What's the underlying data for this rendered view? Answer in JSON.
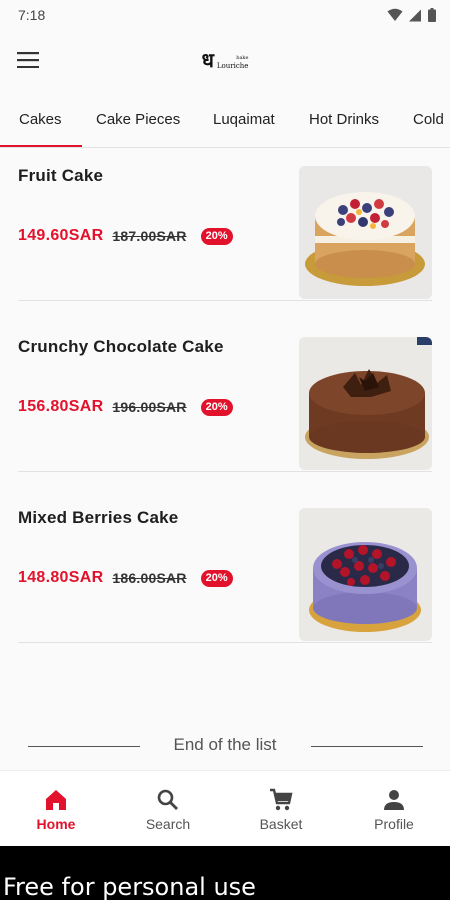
{
  "status_bar": {
    "time": "7:18",
    "icons": [
      "wifi-icon",
      "signal-icon",
      "battery-icon"
    ]
  },
  "header": {
    "menu_icon": "hamburger-menu-icon",
    "logo": {
      "mark": "ध",
      "small": "bake",
      "name": "Louriche"
    }
  },
  "tabs": [
    {
      "label": "Cakes",
      "active": true
    },
    {
      "label": "Cake Pieces",
      "active": false
    },
    {
      "label": "Luqaimat",
      "active": false
    },
    {
      "label": "Hot Drinks",
      "active": false
    },
    {
      "label": "Cold",
      "active": false
    }
  ],
  "products": [
    {
      "name": "Fruit Cake",
      "price": "149.60SAR",
      "old_price": "187.00SAR",
      "discount": "20%",
      "image": "fruit-cake-image"
    },
    {
      "name": "Crunchy Chocolate Cake",
      "price": "156.80SAR",
      "old_price": "196.00SAR",
      "discount": "20%",
      "image": "chocolate-cake-image"
    },
    {
      "name": "Mixed Berries Cake",
      "price": "148.80SAR",
      "old_price": "186.00SAR",
      "discount": "20%",
      "image": "berries-cake-image"
    }
  ],
  "end_of_list": "End of the list",
  "bottom_nav": [
    {
      "label": "Home",
      "icon": "home-icon",
      "active": true
    },
    {
      "label": "Search",
      "icon": "search-icon",
      "active": false
    },
    {
      "label": "Basket",
      "icon": "cart-icon",
      "active": false
    },
    {
      "label": "Profile",
      "icon": "person-icon",
      "active": false
    }
  ],
  "watermark": "Free for personal use",
  "colors": {
    "accent": "#e3122c",
    "background": "#fafafa",
    "text": "#222222"
  }
}
